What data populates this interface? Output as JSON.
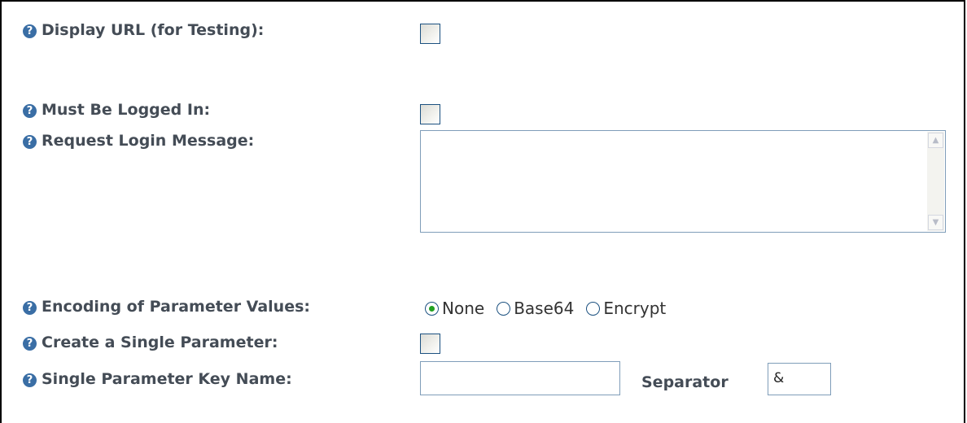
{
  "fields": {
    "display_url": {
      "label": "Display URL (for Testing):",
      "checked": false
    },
    "must_be_logged_in": {
      "label": "Must Be Logged In:",
      "checked": false
    },
    "request_login_message": {
      "label": "Request Login Message:",
      "value": ""
    },
    "encoding": {
      "label": "Encoding of Parameter Values:",
      "options": [
        "None",
        "Base64",
        "Encrypt"
      ],
      "selected": "None"
    },
    "create_single_parameter": {
      "label": "Create a Single Parameter:",
      "checked": false
    },
    "single_parameter_key_name": {
      "label": "Single Parameter Key Name:",
      "value": ""
    },
    "separator": {
      "label": "Separator",
      "value": "&"
    }
  },
  "icons": {
    "help": "help-icon",
    "scroll_up": "scroll-up-arrow-icon",
    "scroll_down": "scroll-down-arrow-icon"
  },
  "colors": {
    "label_text": "#444c56",
    "help_icon": "#3a6ea5",
    "radio_selected": "#21a121",
    "input_border": "#7f9db9",
    "checkbox_border": "#1c5180"
  }
}
